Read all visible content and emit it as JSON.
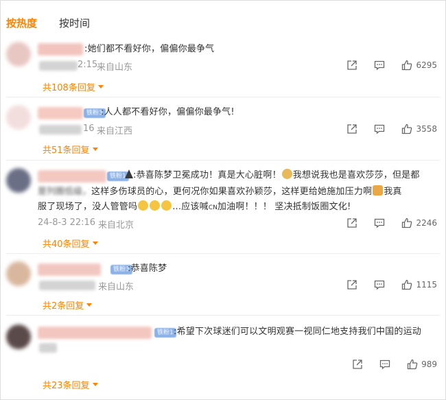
{
  "tabs": [
    {
      "label": "按热度",
      "active": true
    },
    {
      "label": "按时间",
      "active": false
    }
  ],
  "colors": {
    "accent": "#ff8200",
    "meta": "#999999",
    "fan_badge": "#8bb2e6"
  },
  "icons": {
    "share": "share-icon",
    "comment": "comment-icon",
    "like": "thumbs-up-icon"
  },
  "comments": [
    {
      "text": ":她们都不看好你，偏偏你最争气",
      "time_fragment": "2:15",
      "location": "来自山东",
      "likes": "6295",
      "replies": "共108条回复"
    },
    {
      "badge": "铁粉3",
      "text": ":人人都不看好你，偏偏你最争气!",
      "time_fragment": "16",
      "location": "来自江西",
      "likes": "3558",
      "replies": "共51条回复"
    },
    {
      "badge": "铁粉1",
      "text_line1": ":恭喜陈梦卫冕成功！真是大心脏啊！",
      "text_line1b": "我想说我也是喜欢莎莎，但是都",
      "text_line2a": "这样多伤球员的心，更何况你如果喜欢孙颖莎，这样更给她施加压力啊",
      "text_line2b": "我真",
      "text_line3": "服了现场了，没人管管吗",
      "text_line3b": "...应该喊",
      "cn_tag": "CN",
      "text_line3c": "加油啊！！！ 坚决抵制饭圈文化!",
      "time": "24-8-3 22:16",
      "location": "来自北京",
      "likes": "2246",
      "replies": "共40条回复"
    },
    {
      "badge": "铁粉3",
      "text": ":恭喜陈梦",
      "location": "来自山东",
      "likes": "1115",
      "replies": "共2条回复"
    },
    {
      "badge": "铁粉1",
      "text": ":希望下次球迷们可以文明观赛一视同仁地支持我们中国的运动",
      "likes": "989",
      "replies": "共23条回复"
    }
  ]
}
